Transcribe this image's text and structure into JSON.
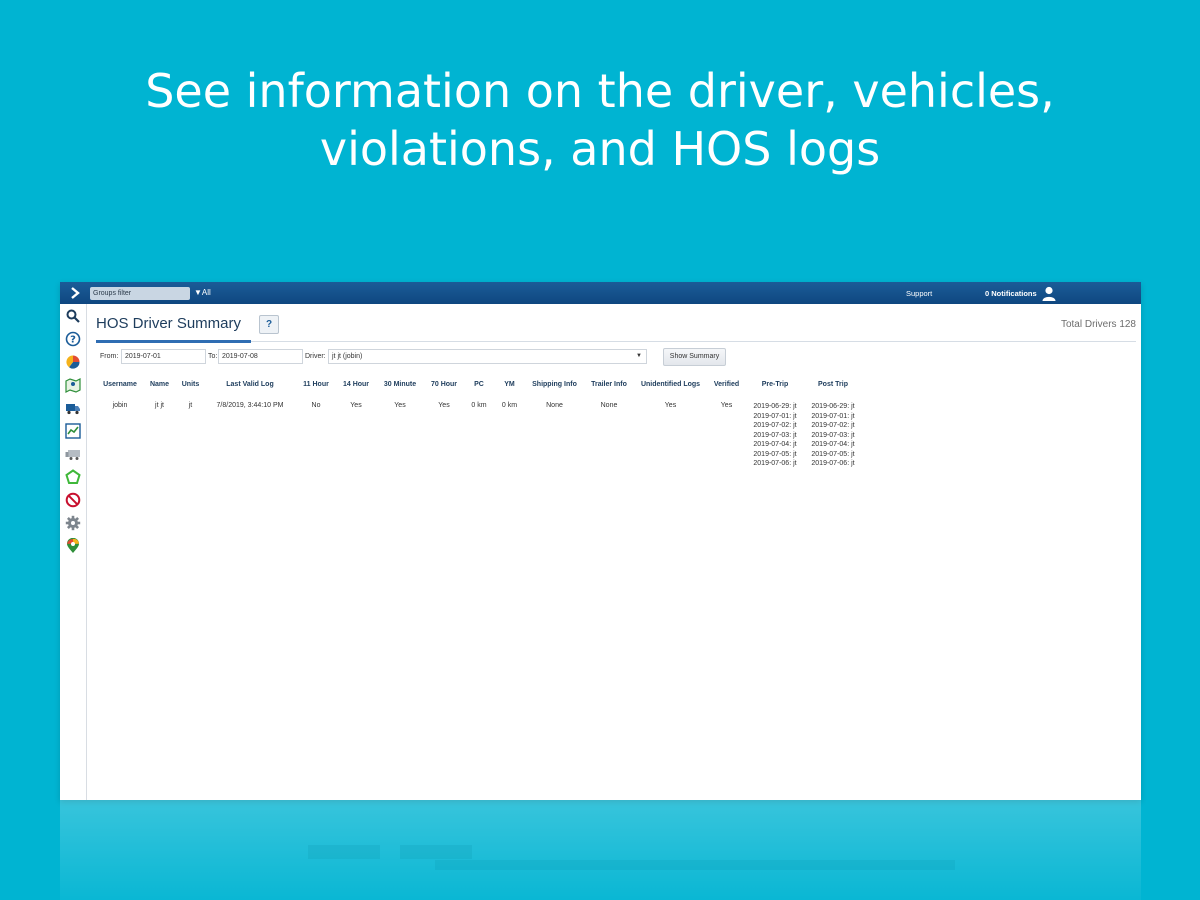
{
  "headline": {
    "line1": "See information on the driver, vehicles,",
    "line2": "violations, and HOS logs"
  },
  "topbar": {
    "groups_filter_placeholder": "Groups filter",
    "groups_all": "All",
    "support": "Support",
    "notifications": "0 Notifications"
  },
  "sidebar": {
    "icons": [
      "search-icon",
      "help-circle-icon",
      "pie-chart-icon",
      "map-icon",
      "truck-icon",
      "chart-line-icon",
      "trailer-icon",
      "route-icon",
      "no-entry-icon",
      "gear-icon",
      "map-pin-icon"
    ]
  },
  "page": {
    "title": "HOS Driver Summary",
    "help": "?",
    "total_drivers": "Total Drivers 128"
  },
  "filters": {
    "from_label": "From:",
    "from_value": "2019-07-01",
    "to_label": "To:",
    "to_value": "2019-07-08",
    "driver_label": "Driver:",
    "driver_value": "jt jt (jobin)",
    "show_summary": "Show Summary"
  },
  "table": {
    "headers": [
      "Username",
      "Name",
      "Units",
      "Last Valid Log",
      "11 Hour",
      "14 Hour",
      "30 Minute",
      "70 Hour",
      "PC",
      "YM",
      "Shipping Info",
      "Trailer Info",
      "Unidentified Logs",
      "Verified",
      "Pre-Trip",
      "Post Trip"
    ],
    "rows": [
      {
        "username": "jobin",
        "name": "jt jt",
        "units": "jt",
        "last_valid_log": "7/8/2019, 3:44:10 PM",
        "h11": "No",
        "h14": "Yes",
        "m30": "Yes",
        "h70": "Yes",
        "pc": "0 km",
        "ym": "0 km",
        "shipping_info": "None",
        "trailer_info": "None",
        "unidentified_logs": "Yes",
        "verified": "Yes",
        "pre_trip": [
          "2019-06-29: jt",
          "2019-07-01: jt",
          "2019-07-02: jt",
          "2019-07-03: jt",
          "2019-07-04: jt",
          "2019-07-05: jt",
          "2019-07-06: jt"
        ],
        "post_trip": [
          "2019-06-29: jt",
          "2019-07-01: jt",
          "2019-07-02: jt",
          "2019-07-03: jt",
          "2019-07-04: jt",
          "2019-07-05: jt",
          "2019-07-06: jt"
        ]
      }
    ]
  },
  "colors": {
    "background": "#00b4d2",
    "topbar": "#134f89",
    "accent": "#2f6db3"
  }
}
